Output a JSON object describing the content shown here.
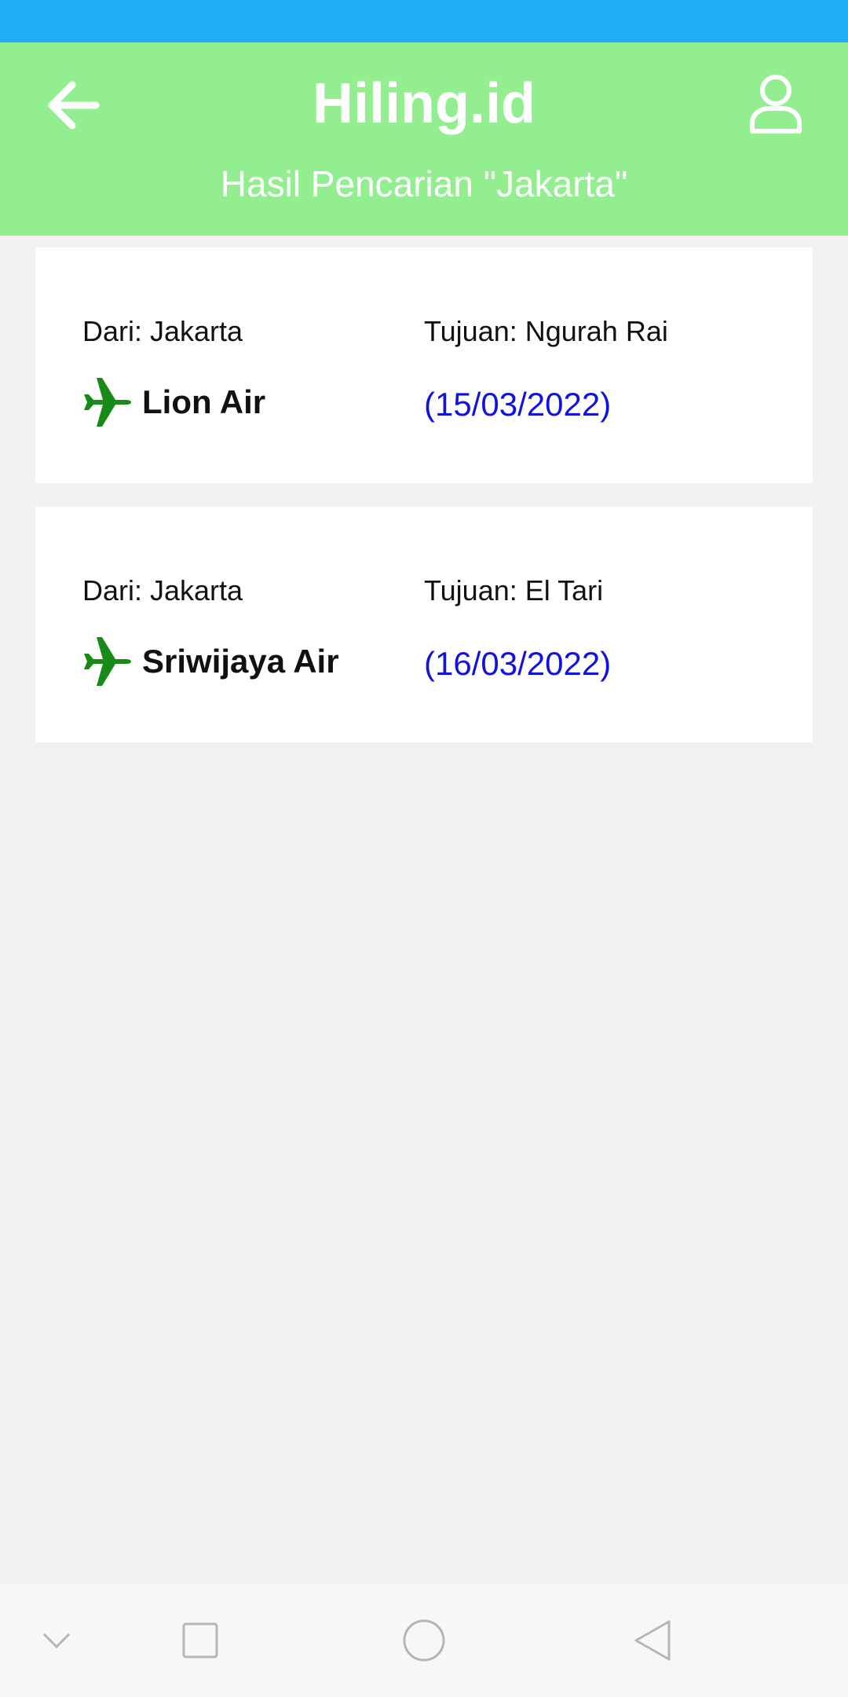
{
  "header": {
    "title": "Hiling.id",
    "subtitle": "Hasil Pencarian \"Jakarta\""
  },
  "results": [
    {
      "from": "Dari: Jakarta",
      "to": "Tujuan: Ngurah Rai",
      "airline": "Lion Air",
      "date": "(15/03/2022)"
    },
    {
      "from": "Dari: Jakarta",
      "to": "Tujuan: El Tari",
      "airline": "Sriwijaya Air",
      "date": "(16/03/2022)"
    }
  ],
  "icons": {
    "back": "arrow-left-icon",
    "profile": "user-icon",
    "airline": "airplane-icon",
    "nav": [
      "chevron-down-icon",
      "square-icon",
      "circle-icon",
      "triangle-back-icon"
    ]
  },
  "colors": {
    "status_bar": "#1eaef6",
    "header": "#92ee8f",
    "plane": "#188a18",
    "date": "#1212e0"
  }
}
